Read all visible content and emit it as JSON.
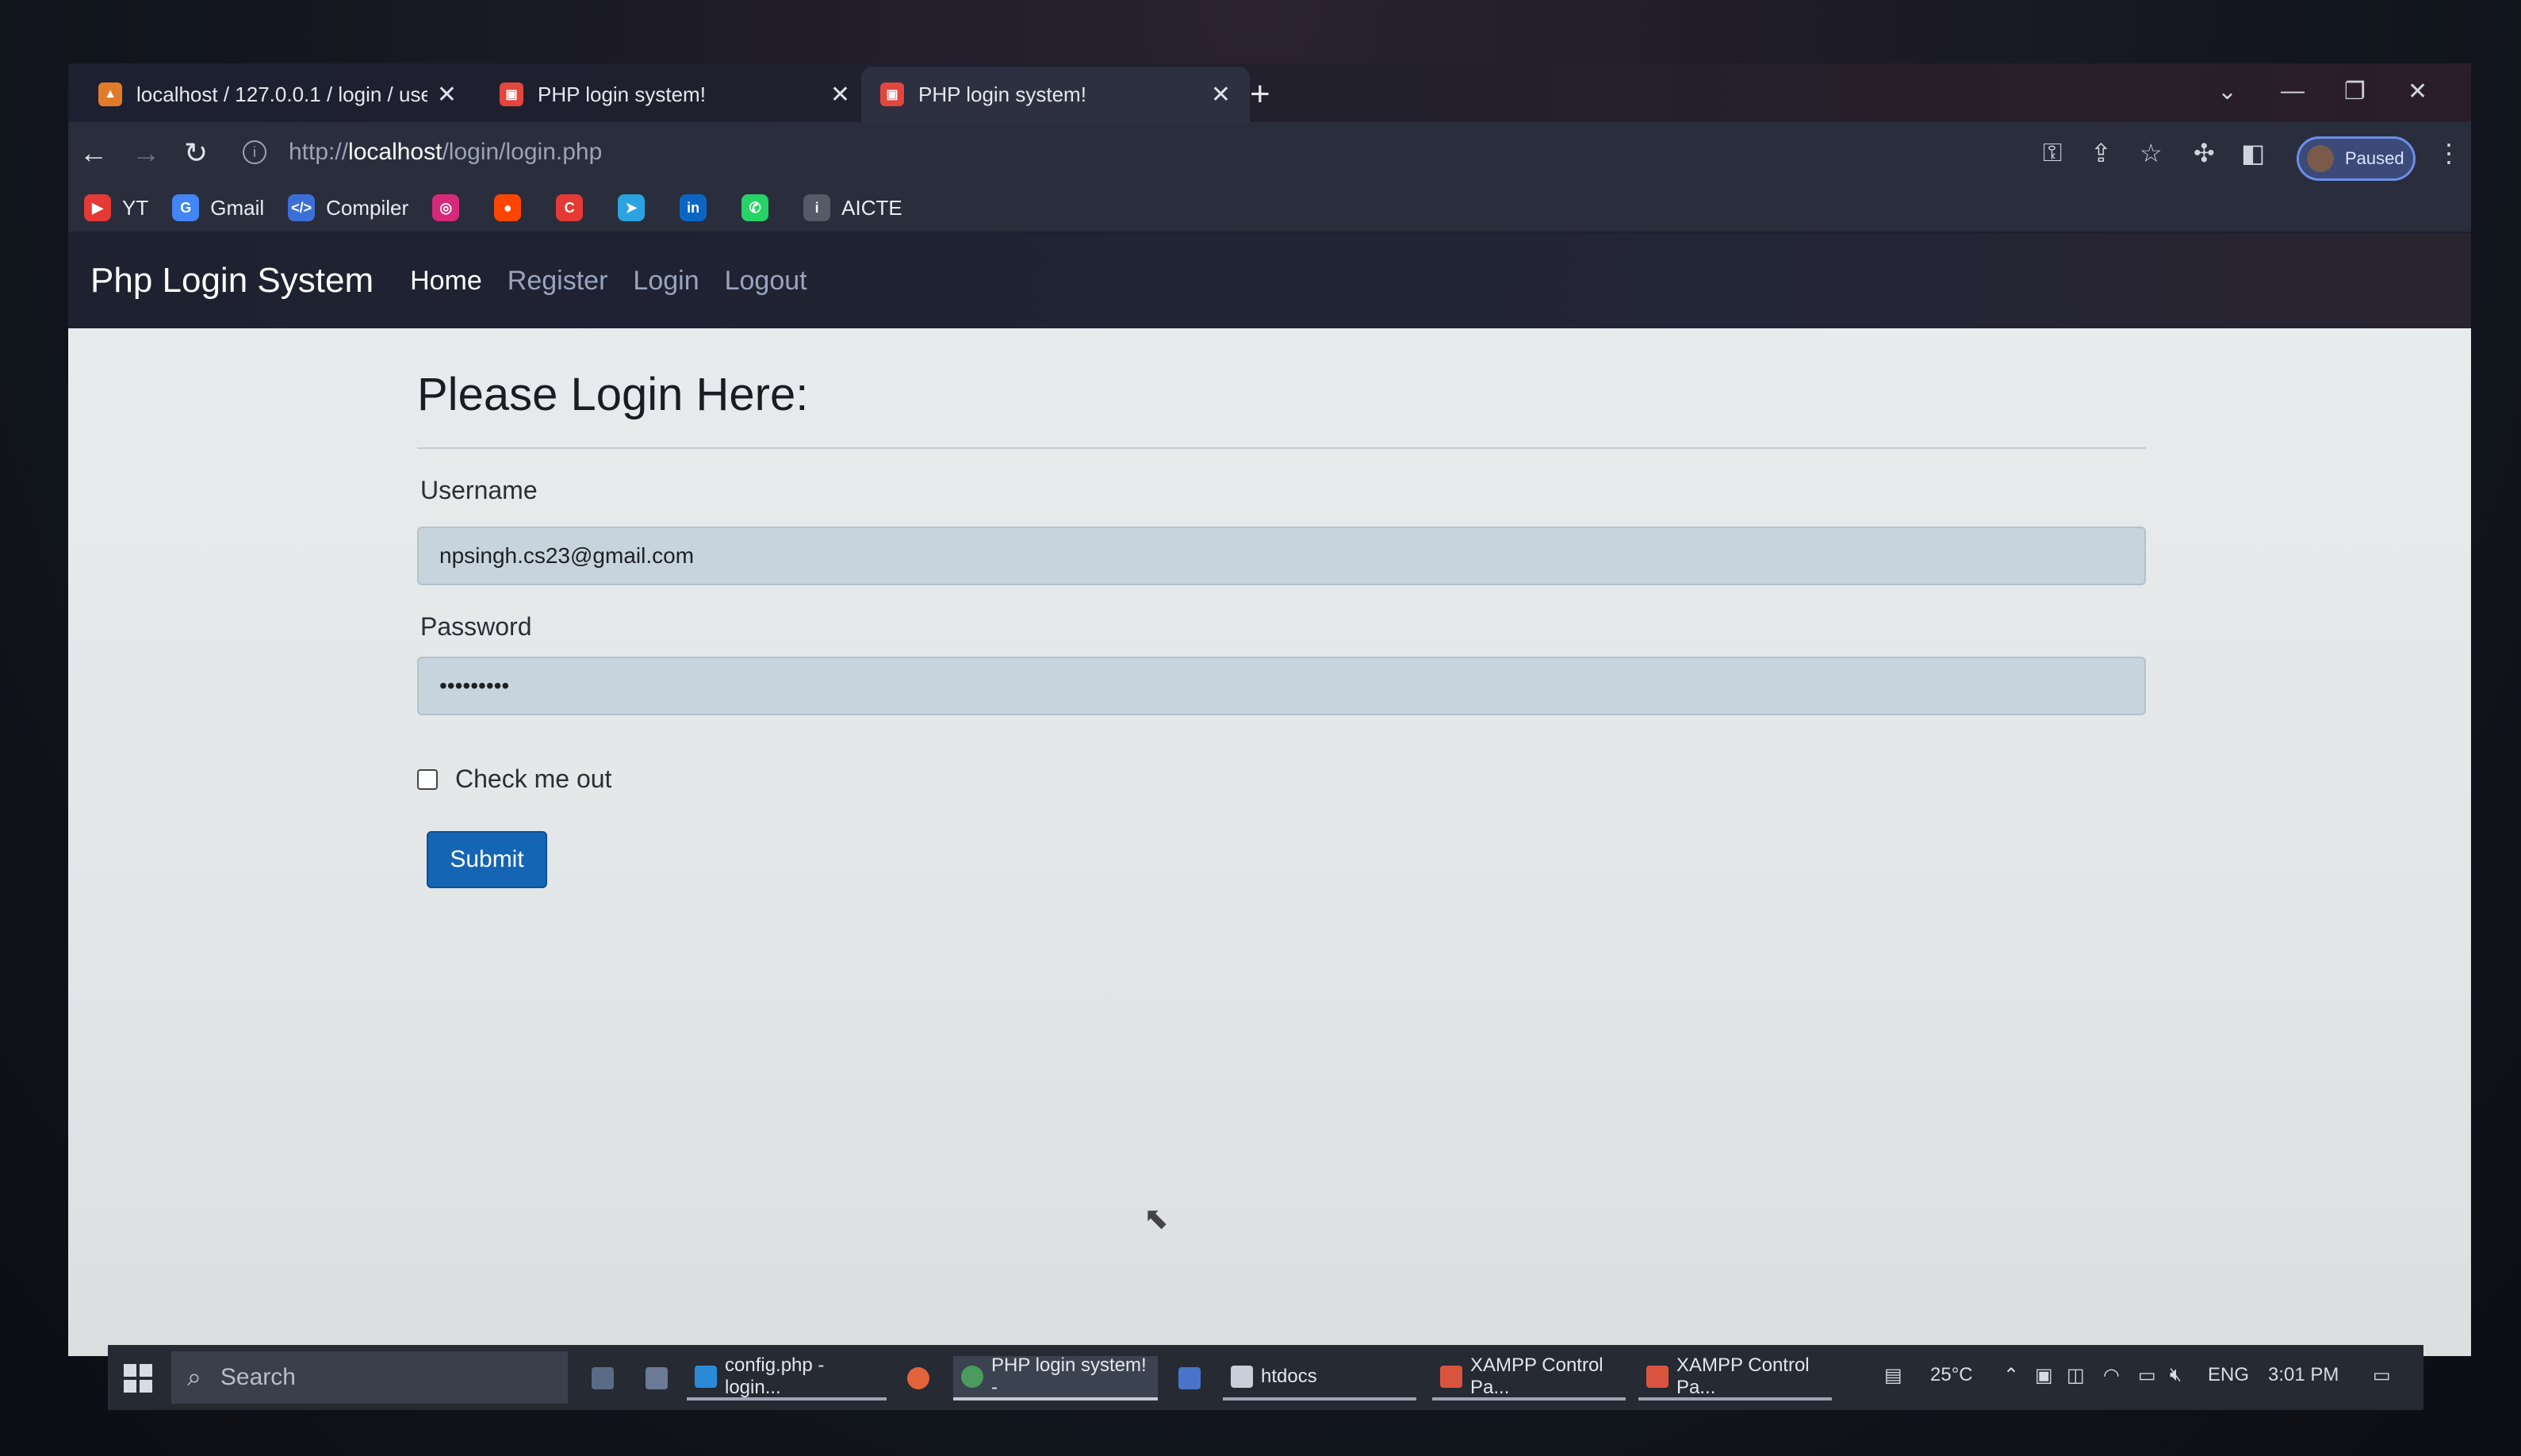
{
  "tabs": [
    {
      "title": "localhost / 127.0.0.1 / login / use",
      "active": true
    },
    {
      "title": "PHP login system!",
      "active": false
    },
    {
      "title": "PHP login system!",
      "active": true
    }
  ],
  "address_bar": {
    "prefix": "http://",
    "host": "localhost",
    "path": "/login/login.php"
  },
  "profile": {
    "label": "Paused"
  },
  "bookmarks": [
    {
      "label": "YT",
      "icon": "youtube-icon",
      "color": "#e53935"
    },
    {
      "label": "Gmail",
      "icon": "google-icon",
      "color": "#4285f4"
    },
    {
      "label": "Compiler",
      "icon": "code-icon",
      "color": "#3b6fd8"
    },
    {
      "label": "",
      "icon": "instagram-icon",
      "color": "#d6297a"
    },
    {
      "label": "",
      "icon": "reddit-icon",
      "color": "#ff4500"
    },
    {
      "label": "",
      "icon": "app-icon",
      "color": "#e53935"
    },
    {
      "label": "",
      "icon": "telegram-icon",
      "color": "#2aa3e0"
    },
    {
      "label": "",
      "icon": "linkedin-icon",
      "color": "#0a66c2"
    },
    {
      "label": "",
      "icon": "whatsapp-icon",
      "color": "#25d366"
    },
    {
      "label": "AICTE",
      "icon": "info-icon",
      "color": "#555a66"
    }
  ],
  "site": {
    "brand": "Php Login System",
    "nav": [
      "Home",
      "Register",
      "Login",
      "Logout"
    ],
    "active_nav": "Home"
  },
  "form": {
    "heading": "Please Login Here:",
    "username_label": "Username",
    "username_value": "npsingh.cs23@gmail.com",
    "password_label": "Password",
    "password_value": "•••••••••",
    "checkbox_label": "Check me out",
    "checkbox_checked": false,
    "submit_label": "Submit"
  },
  "taskbar": {
    "search_placeholder": "Search",
    "items": [
      {
        "label": "config.php - login...",
        "icon": "vscode-icon"
      },
      {
        "label": "PHP login system! -",
        "icon": "chrome-icon"
      },
      {
        "label": "htdocs",
        "icon": "folder-icon"
      },
      {
        "label": "XAMPP Control Pa...",
        "icon": "xampp-icon"
      },
      {
        "label": "XAMPP Control Pa...",
        "icon": "xampp-icon"
      }
    ],
    "weather": "25°C",
    "language": "ENG",
    "time": "3:01 PM"
  }
}
